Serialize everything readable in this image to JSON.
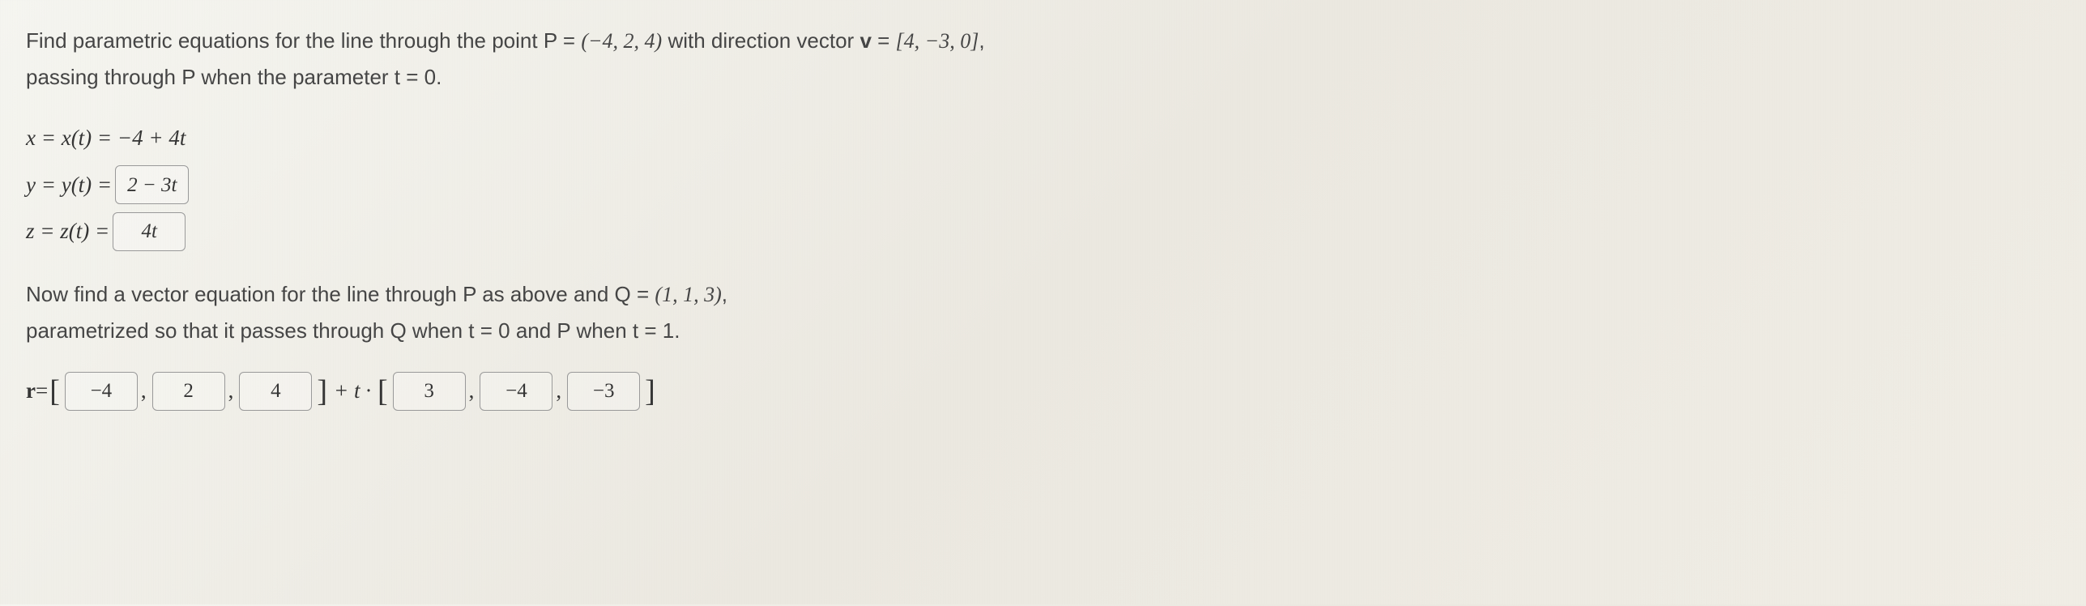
{
  "question1": {
    "line1_pre": "Find parametric equations for the line through the point P = ",
    "point_P": "(−4, 2, 4)",
    "line1_mid": " with direction vector ",
    "vector_v_label": "v",
    "vector_v_eq": " = ",
    "vector_v_val": "[4, −3, 0]",
    "line1_end": ",",
    "line2": "passing through P when the parameter t = 0."
  },
  "equations": {
    "x_prefix": "x = x(t) = −4 + 4t",
    "y_prefix": "y = y(t) = ",
    "y_input": "2 − 3t",
    "z_prefix": "z = z(t) = ",
    "z_input": "4t"
  },
  "question2": {
    "line1_pre": "Now find a vector equation for the line through P as above and Q = ",
    "point_Q": "(1, 1, 3)",
    "line1_end": ",",
    "line2": "parametrized so that it passes through Q when t = 0 and P when t = 1."
  },
  "vector_eq": {
    "prefix_r": "r",
    "eq": " = ",
    "b1": "−4",
    "b2": "2",
    "b3": "4",
    "mid": " + t · ",
    "c1": "3",
    "c2": "−4",
    "c3": "−3"
  }
}
